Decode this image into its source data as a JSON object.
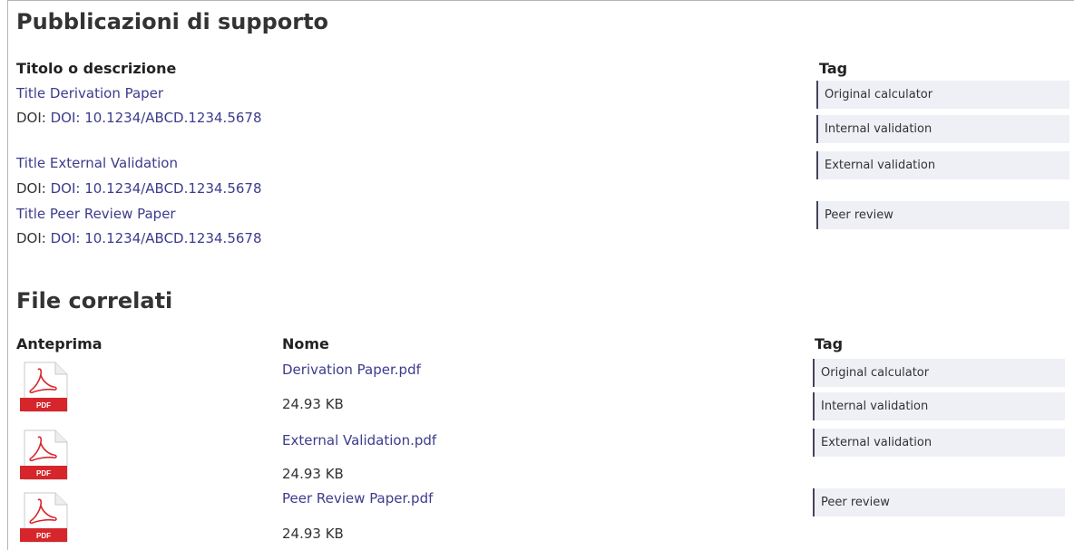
{
  "publications": {
    "heading": "Pubblicazioni di supporto",
    "col_title": "Titolo o descrizione",
    "col_tag": "Tag",
    "items": [
      {
        "title": "Title Derivation Paper",
        "doi_prefix": "DOI: ",
        "doi_link": "DOI: 10.1234/ABCD.1234.5678"
      },
      {
        "title": "Title External Validation",
        "doi_prefix": "DOI: ",
        "doi_link": "DOI: 10.1234/ABCD.1234.5678"
      },
      {
        "title": "Title Peer Review Paper",
        "doi_prefix": "DOI: ",
        "doi_link": "DOI: 10.1234/ABCD.1234.5678"
      }
    ],
    "tags": [
      "Original calculator",
      "Internal validation",
      "External validation",
      "Peer review"
    ]
  },
  "files": {
    "heading": "File correlati",
    "col_preview": "Anteprima",
    "col_name": "Nome",
    "col_tag": "Tag",
    "items": [
      {
        "name": "Derivation Paper.pdf",
        "size": "24.93 KB",
        "icon": "pdf-file-icon"
      },
      {
        "name": "External Validation.pdf",
        "size": "24.93 KB",
        "icon": "pdf-file-icon"
      },
      {
        "name": "Peer Review Paper.pdf",
        "size": "24.93 KB",
        "icon": "pdf-file-icon"
      }
    ],
    "tags": [
      "Original calculator",
      "Internal validation",
      "External validation",
      "Peer review"
    ],
    "pdf_label": "PDF"
  },
  "colors": {
    "link": "#3c3c8c",
    "tag_bg": "#eef0f6",
    "tag_border": "#44455a",
    "pdf_red": "#d7262b"
  }
}
